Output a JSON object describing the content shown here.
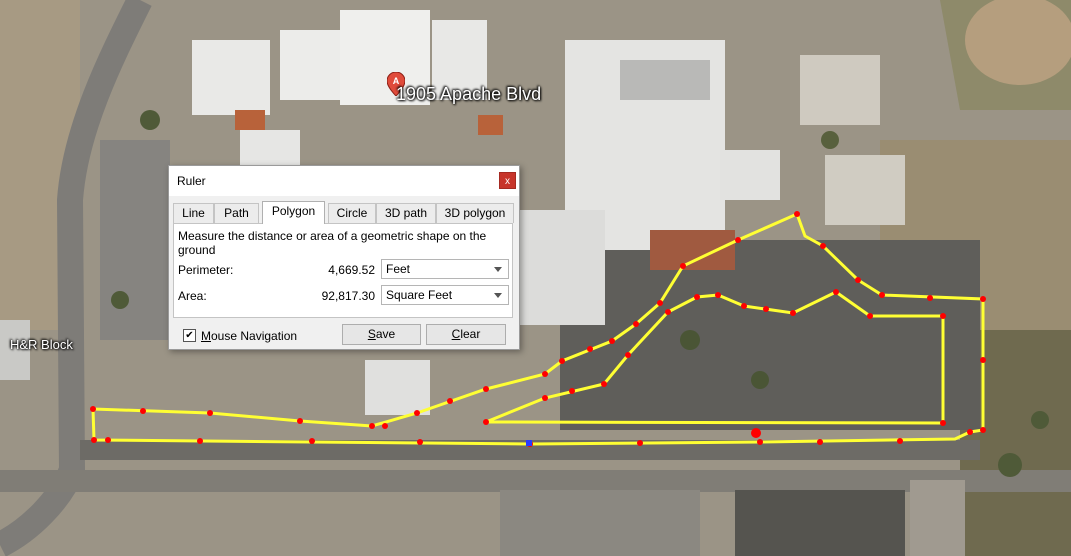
{
  "map": {
    "place_label": "1905 Apache Blvd",
    "place_pin_letter": "A",
    "business_label": "H&R Block",
    "measure_line_color": "#ffff33",
    "vertex_color": "#ff0000"
  },
  "ruler": {
    "title": "Ruler",
    "close_glyph": "x",
    "tabs": [
      {
        "label": "Line",
        "active": false
      },
      {
        "label": "Path",
        "active": false
      },
      {
        "label": "Polygon",
        "active": true
      },
      {
        "label": "Circle",
        "active": false
      },
      {
        "label": "3D path",
        "active": false
      },
      {
        "label": "3D polygon",
        "active": false
      }
    ],
    "description": "Measure the distance or area of a geometric shape on the ground",
    "perimeter": {
      "label": "Perimeter:",
      "value": "4,669.52",
      "unit": "Feet"
    },
    "area": {
      "label": "Area:",
      "value": "92,817.30",
      "unit": "Square Feet"
    },
    "mouse_navigation": {
      "label_u": "M",
      "label_rest": "ouse Navigation",
      "checked": true,
      "check_glyph": "✔"
    },
    "save_button": {
      "label_u": "S",
      "label_rest": "ave"
    },
    "clear_button": {
      "label_u": "C",
      "label_rest": "lear"
    }
  }
}
